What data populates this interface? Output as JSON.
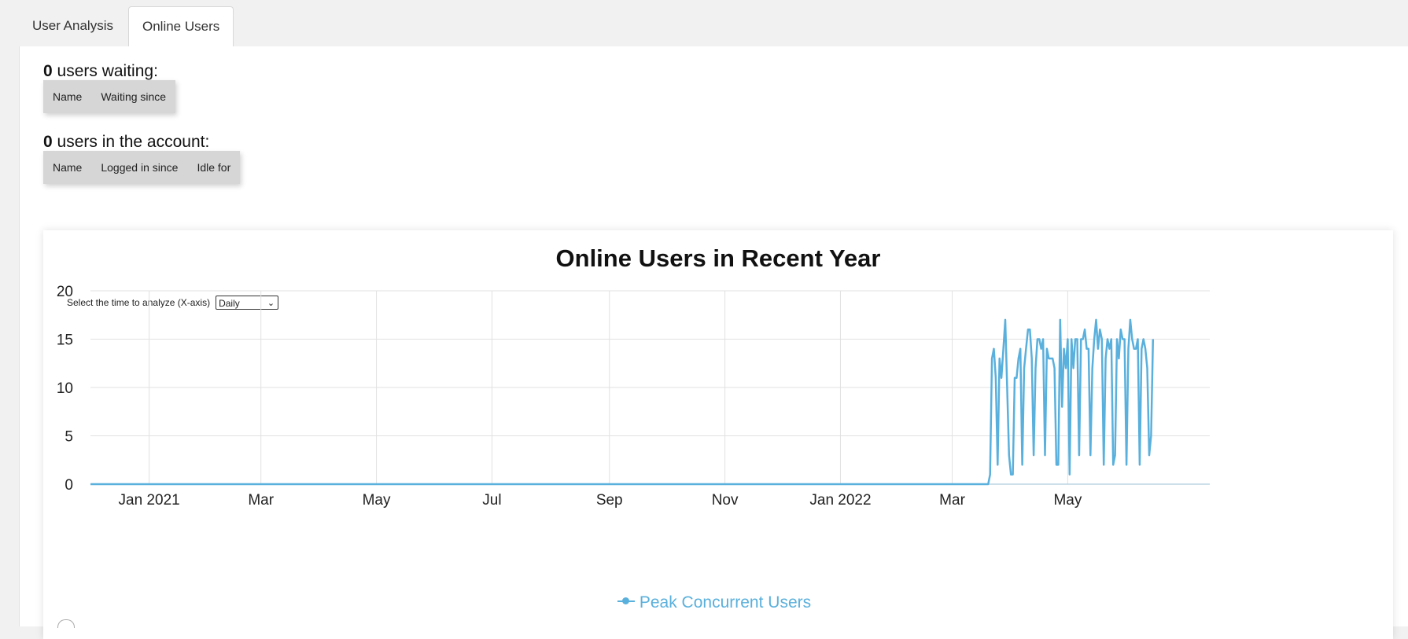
{
  "tabs": [
    {
      "label": "User Analysis",
      "active": false
    },
    {
      "label": "Online Users",
      "active": true
    }
  ],
  "waiting": {
    "count": "0",
    "suffix": " users waiting:",
    "columns": [
      "Name",
      "Waiting since"
    ]
  },
  "account": {
    "count": "0",
    "suffix": " users in the account:",
    "columns": [
      "Name",
      "Logged in since",
      "Idle for"
    ]
  },
  "chart": {
    "title": "Online Users in Recent Year",
    "selector_label": "Select the time to analyze (X-axis)",
    "selector_value": "Daily",
    "legend_label": "Peak Concurrent Users",
    "color": "#5ab0dc"
  },
  "chart_data": {
    "type": "line",
    "title": "Online Users in Recent Year",
    "xlabel": "",
    "ylabel": "",
    "ylim": [
      0,
      20
    ],
    "y_ticks": [
      0,
      5,
      10,
      15,
      20
    ],
    "x_range": [
      "2020-12-01",
      "2022-07-15"
    ],
    "x_ticks": [
      {
        "date": "2021-01-01",
        "label": "Jan 2021"
      },
      {
        "date": "2021-03-01",
        "label": "Mar"
      },
      {
        "date": "2021-05-01",
        "label": "May"
      },
      {
        "date": "2021-07-01",
        "label": "Jul"
      },
      {
        "date": "2021-09-01",
        "label": "Sep"
      },
      {
        "date": "2021-11-01",
        "label": "Nov"
      },
      {
        "date": "2022-01-01",
        "label": "Jan 2022"
      },
      {
        "date": "2022-03-01",
        "label": "Mar"
      },
      {
        "date": "2022-05-01",
        "label": "May"
      }
    ],
    "grid": true,
    "legend_placement": "bottom",
    "series": [
      {
        "name": "Peak Concurrent Users",
        "color": "#5ab0dc",
        "points": [
          [
            "2020-12-01",
            0
          ],
          [
            "2022-03-20",
            0
          ],
          [
            "2022-03-21",
            1
          ],
          [
            "2022-03-22",
            13
          ],
          [
            "2022-03-23",
            14
          ],
          [
            "2022-03-24",
            11
          ],
          [
            "2022-03-25",
            2
          ],
          [
            "2022-03-26",
            13
          ],
          [
            "2022-03-27",
            11
          ],
          [
            "2022-03-28",
            14
          ],
          [
            "2022-03-29",
            17
          ],
          [
            "2022-03-30",
            10
          ],
          [
            "2022-03-31",
            3
          ],
          [
            "2022-04-01",
            1
          ],
          [
            "2022-04-02",
            1
          ],
          [
            "2022-04-03",
            11
          ],
          [
            "2022-04-04",
            11
          ],
          [
            "2022-04-05",
            13
          ],
          [
            "2022-04-06",
            14
          ],
          [
            "2022-04-07",
            2
          ],
          [
            "2022-04-08",
            12
          ],
          [
            "2022-04-09",
            14
          ],
          [
            "2022-04-10",
            16
          ],
          [
            "2022-04-11",
            16
          ],
          [
            "2022-04-12",
            13
          ],
          [
            "2022-04-13",
            3
          ],
          [
            "2022-04-14",
            12
          ],
          [
            "2022-04-15",
            15
          ],
          [
            "2022-04-16",
            15
          ],
          [
            "2022-04-17",
            14
          ],
          [
            "2022-04-18",
            15
          ],
          [
            "2022-04-19",
            3
          ],
          [
            "2022-04-20",
            14
          ],
          [
            "2022-04-21",
            13
          ],
          [
            "2022-04-22",
            13
          ],
          [
            "2022-04-23",
            13
          ],
          [
            "2022-04-24",
            12
          ],
          [
            "2022-04-25",
            2
          ],
          [
            "2022-04-26",
            2
          ],
          [
            "2022-04-27",
            17
          ],
          [
            "2022-04-28",
            8
          ],
          [
            "2022-04-29",
            14
          ],
          [
            "2022-04-30",
            12
          ],
          [
            "2022-05-01",
            15
          ],
          [
            "2022-05-02",
            1
          ],
          [
            "2022-05-03",
            15
          ],
          [
            "2022-05-04",
            12
          ],
          [
            "2022-05-05",
            15
          ],
          [
            "2022-05-06",
            15
          ],
          [
            "2022-05-07",
            3
          ],
          [
            "2022-05-08",
            15
          ],
          [
            "2022-05-09",
            15
          ],
          [
            "2022-05-10",
            16
          ],
          [
            "2022-05-11",
            14
          ],
          [
            "2022-05-12",
            14
          ],
          [
            "2022-05-13",
            3
          ],
          [
            "2022-05-14",
            12
          ],
          [
            "2022-05-15",
            15
          ],
          [
            "2022-05-16",
            17
          ],
          [
            "2022-05-17",
            14
          ],
          [
            "2022-05-18",
            16
          ],
          [
            "2022-05-19",
            15
          ],
          [
            "2022-05-20",
            2
          ],
          [
            "2022-05-21",
            13
          ],
          [
            "2022-05-22",
            15
          ],
          [
            "2022-05-23",
            14
          ],
          [
            "2022-05-24",
            15
          ],
          [
            "2022-05-25",
            2
          ],
          [
            "2022-05-26",
            3
          ],
          [
            "2022-05-27",
            15
          ],
          [
            "2022-05-28",
            13
          ],
          [
            "2022-05-29",
            16
          ],
          [
            "2022-05-30",
            15
          ],
          [
            "2022-05-31",
            15
          ],
          [
            "2022-06-01",
            2
          ],
          [
            "2022-06-02",
            14
          ],
          [
            "2022-06-03",
            17
          ],
          [
            "2022-06-04",
            15
          ],
          [
            "2022-06-05",
            14
          ],
          [
            "2022-06-06",
            14
          ],
          [
            "2022-06-07",
            15
          ],
          [
            "2022-06-08",
            2
          ],
          [
            "2022-06-09",
            14
          ],
          [
            "2022-06-10",
            15
          ],
          [
            "2022-06-11",
            14
          ],
          [
            "2022-06-12",
            12
          ],
          [
            "2022-06-13",
            3
          ],
          [
            "2022-06-14",
            5
          ],
          [
            "2022-06-15",
            15
          ]
        ]
      }
    ]
  }
}
